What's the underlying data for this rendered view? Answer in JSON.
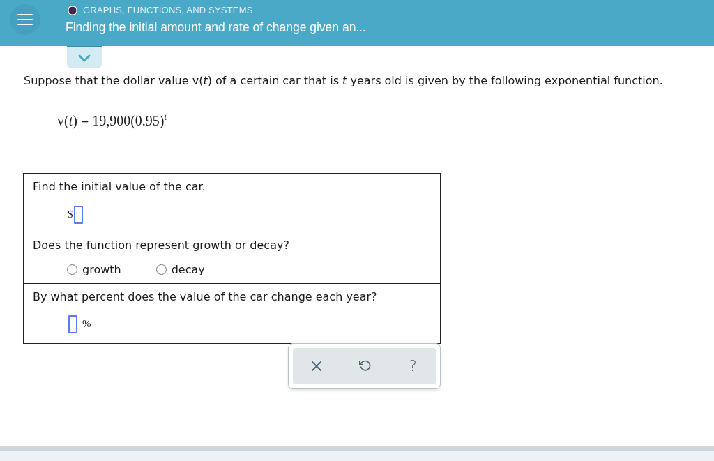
{
  "header": {
    "category": "GRAPHS, FUNCTIONS, AND SYSTEMS",
    "title": "Finding the initial amount and rate of change given an..."
  },
  "problem": {
    "statement": "Suppose that the dollar value v(*t*) of a certain car that is *t* years old is given by the following exponential function.",
    "formula": "v(*t*) = 19,900(0.95)$^{t}$"
  },
  "questions": [
    {
      "kind": "input",
      "prompt": "Find the initial value of the car.",
      "prefix": "$"
    },
    {
      "kind": "choice",
      "prompt": "Does the function represent growth or decay?",
      "options": [
        {
          "label": "growth",
          "selected": false
        },
        {
          "label": "decay",
          "selected": false
        }
      ]
    },
    {
      "kind": "input",
      "prompt": "By what percent does the value of the car change each year?",
      "suffix": "%"
    }
  ],
  "toolbar": [
    {
      "kind": "clear"
    },
    {
      "kind": "undo"
    },
    {
      "kind": "help",
      "label": "?"
    }
  ]
}
